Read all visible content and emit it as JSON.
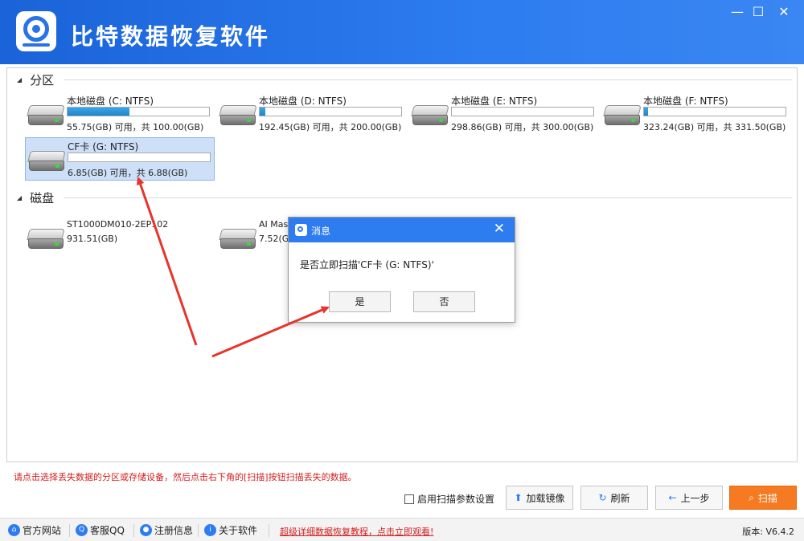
{
  "app": {
    "title": "比特数据恢复软件",
    "window_controls": {
      "minimize": "—",
      "maximize": "☐",
      "close": "✕"
    }
  },
  "partitions_section": {
    "label": "分区",
    "collapse_icon": "triangle-down-icon"
  },
  "partitions": [
    {
      "name": "本地磁盘 (C: NTFS)",
      "info": "55.75(GB) 可用，共 100.00(GB)",
      "used_fraction": 0.44
    },
    {
      "name": "本地磁盘 (D: NTFS)",
      "info": "192.45(GB) 可用，共 200.00(GB)",
      "used_fraction": 0.04
    },
    {
      "name": "本地磁盘 (E: NTFS)",
      "info": "298.86(GB) 可用，共 300.00(GB)",
      "used_fraction": 0.0
    },
    {
      "name": "本地磁盘 (F: NTFS)",
      "info": "323.24(GB) 可用，共 331.50(GB)",
      "used_fraction": 0.03
    },
    {
      "name": "CF卡 (G: NTFS)",
      "info": "6.85(GB) 可用，共 6.88(GB)",
      "used_fraction": 0.0,
      "selected": true
    }
  ],
  "disks_section": {
    "label": "磁盘",
    "collapse_icon": "triangle-down-icon"
  },
  "disks": [
    {
      "name": "ST1000DM010-2EP102",
      "info": "931.51(GB)"
    },
    {
      "name": "AI Mass",
      "info": "7.52(GB)"
    }
  ],
  "dialog": {
    "title": "消息",
    "message": "是否立即扫描'CF卡 (G: NTFS)'",
    "yes": "是",
    "no": "否",
    "close": "✕"
  },
  "hint": "请点击选择丢失数据的分区或存储设备，然后点击右下角的[扫描]按钮扫描丢失的数据。",
  "toolbar": {
    "checkbox_label": "启用扫描参数设置",
    "load_image": "加载镜像",
    "refresh": "刷新",
    "back": "上一步",
    "scan": "扫描"
  },
  "footer": {
    "website": "官方网站",
    "support": "客服QQ",
    "register": "注册信息",
    "about": "关于软件",
    "tutorial": "超级详细数据恢复教程，点击立即观看!",
    "version": "版本: V6.4.2"
  },
  "colors": {
    "title_bar": "#2d7cf0",
    "scan_button": "#f57a22",
    "hint_text": "#d01f1f",
    "annotation_arrow": "#e8342a"
  }
}
